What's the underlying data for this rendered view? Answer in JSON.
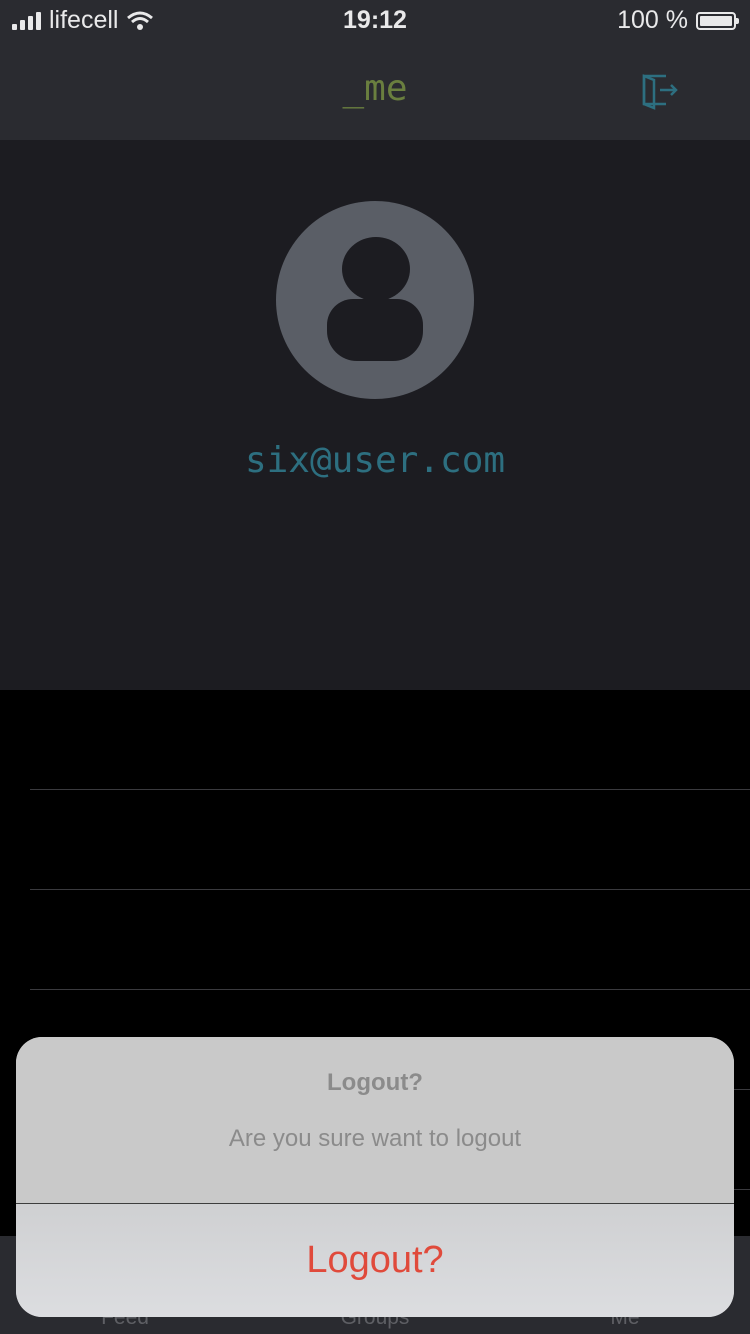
{
  "status_bar": {
    "carrier": "lifecell",
    "time": "19:12",
    "battery": "100 %"
  },
  "nav": {
    "title": "_me",
    "logout_icon": "logout-icon"
  },
  "profile": {
    "email": "six@user.com",
    "avatar_icon": "user-avatar-icon"
  },
  "tabs": [
    {
      "label": "Feed"
    },
    {
      "label": "Groups"
    },
    {
      "label": "Me"
    }
  ],
  "alert": {
    "title": "Logout?",
    "message": "Are you sure want to logout",
    "action_label": "Logout?",
    "action_color": "#e04a3b"
  }
}
